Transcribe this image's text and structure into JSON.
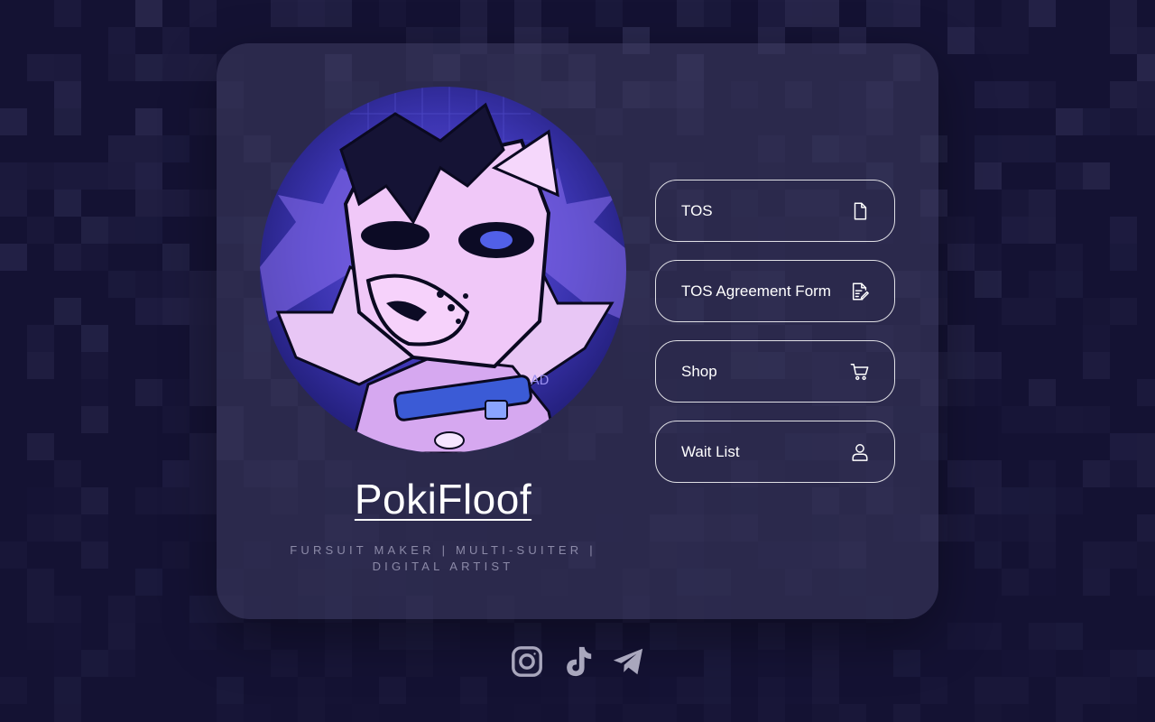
{
  "profile": {
    "name": "PokiFloof",
    "tagline_line1": "FURSUIT MAKER | MULTI-SUITER |",
    "tagline_line2": "DIGITAL ARTIST",
    "avatar_watermark": "AD"
  },
  "links": [
    {
      "label": "TOS",
      "icon": "file-icon"
    },
    {
      "label": "TOS Agreement Form",
      "icon": "form-edit-icon"
    },
    {
      "label": "Shop",
      "icon": "cart-icon"
    },
    {
      "label": "Wait List",
      "icon": "user-icon"
    }
  ],
  "socials": [
    {
      "icon": "instagram-icon"
    },
    {
      "icon": "tiktok-icon"
    },
    {
      "icon": "telegram-icon"
    }
  ],
  "colors": {
    "background": "#141233",
    "card": "#3e3c60",
    "text": "#ffffff",
    "muted": "#8c8aa8",
    "social_icon": "#a9a7bd"
  }
}
